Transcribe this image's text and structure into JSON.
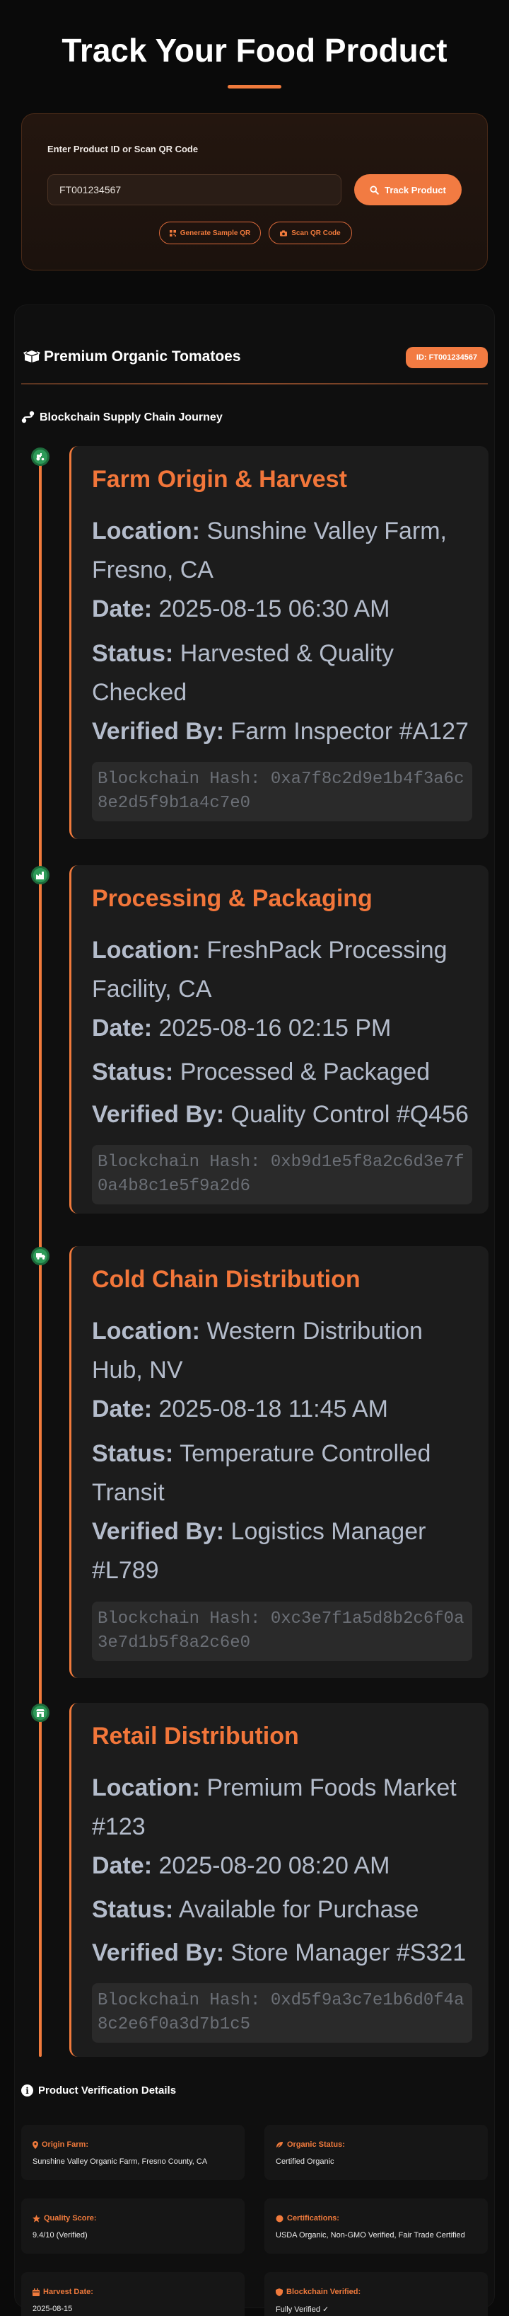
{
  "page": {
    "title": "Track Your Food Product"
  },
  "search": {
    "label": "Enter Product ID or Scan QR Code",
    "input_value": "FT001234567",
    "track_label": "Track Product",
    "sample_label": "Generate Sample QR",
    "scan_label": "Scan QR Code"
  },
  "product": {
    "name": "Premium Organic Tomatoes",
    "id_badge": "ID: FT001234567"
  },
  "journey": {
    "title": "Blockchain Supply Chain Journey",
    "field_labels": {
      "location": "Location:",
      "date": "Date:",
      "status": "Status:",
      "verified_by": "Verified By:",
      "hash": "Blockchain Hash:"
    },
    "stages": [
      {
        "icon": "tractor-icon",
        "title": "Farm Origin & Harvest",
        "location": "Sunshine Valley Farm, Fresno, CA",
        "date": "2025-08-15 06:30 AM",
        "status": "Harvested & Quality Checked",
        "verified_by": "Farm Inspector #A127",
        "hash": "0xa7f8c2d9e1b4f3a6c8e2d5f9b1a4c7e0"
      },
      {
        "icon": "factory-icon",
        "title": "Processing & Packaging",
        "location": "FreshPack Processing Facility, CA",
        "date": "2025-08-16 02:15 PM",
        "status": "Processed & Packaged",
        "verified_by": "Quality Control #Q456",
        "hash": "0xb9d1e5f8a2c6d3e7f0a4b8c1e5f9a2d6"
      },
      {
        "icon": "truck-icon",
        "title": "Cold Chain Distribution",
        "location": "Western Distribution Hub, NV",
        "date": "2025-08-18 11:45 AM",
        "status": "Temperature Controlled Transit",
        "verified_by": "Logistics Manager #L789",
        "hash": "0xc3e7f1a5d8b2c6f0a3e7d1b5f8a2c6e0"
      },
      {
        "icon": "store-icon",
        "title": "Retail Distribution",
        "location": "Premium Foods Market #123",
        "date": "2025-08-20 08:20 AM",
        "status": "Available for Purchase",
        "verified_by": "Store Manager #S321",
        "hash": "0xd5f9a3c7e1b6d0f4a8c2e6f0a3d7b1c5"
      }
    ]
  },
  "verification": {
    "title": "Product Verification Details",
    "details": [
      {
        "icon": "map-pin-icon",
        "label": "Origin Farm:",
        "value": "Sunshine Valley Organic Farm, Fresno County, CA"
      },
      {
        "icon": "leaf-icon",
        "label": "Organic Status:",
        "value": "Certified Organic"
      },
      {
        "icon": "star-icon",
        "label": "Quality Score:",
        "value": "9.4/10 (Verified)"
      },
      {
        "icon": "certificate-icon",
        "label": "Certifications:",
        "value": "USDA Organic, Non-GMO Verified, Fair Trade Certified"
      },
      {
        "icon": "calendar-icon",
        "label": "Harvest Date:",
        "value": "2025-08-15"
      },
      {
        "icon": "shield-icon",
        "label": "Blockchain Verified:",
        "value": "Fully Verified ✓"
      }
    ]
  },
  "colors": {
    "accent": "#f27b42",
    "stage_dot": "#2d9b58",
    "background": "#0a0a0a",
    "card": "#1c1c1c"
  }
}
